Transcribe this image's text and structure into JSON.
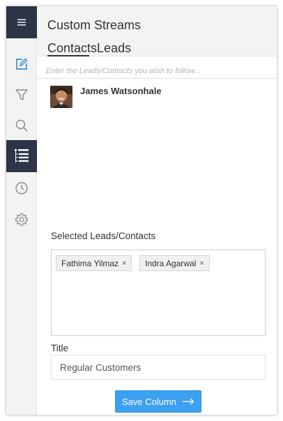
{
  "colors": {
    "sidebar_dark": "#2d3446",
    "accent": "#3ea0f0",
    "compose_icon": "#3a8fd9"
  },
  "sidebar": {
    "menu_icon": "hamburger-icon",
    "items": [
      {
        "icon": "compose-icon"
      },
      {
        "icon": "filter-icon"
      },
      {
        "icon": "search-icon"
      },
      {
        "icon": "list-icon",
        "active": true
      },
      {
        "icon": "clock-icon"
      },
      {
        "icon": "gear-icon"
      }
    ]
  },
  "header": {
    "title": "Custom Streams",
    "tabs": [
      "Contacts",
      "Leads"
    ]
  },
  "search": {
    "placeholder": "Enter the Leads/Contacts you wish to follow..."
  },
  "results": [
    {
      "name": "James Watsonhale"
    }
  ],
  "selected": {
    "label": "Selected Leads/Contacts",
    "chips": [
      "Fathima Yilmaz",
      "Indra Agarwal"
    ],
    "remove_symbol": "×"
  },
  "title_field": {
    "label": "Title",
    "value": "Regular Customers"
  },
  "save_button": {
    "label": "Save Column"
  }
}
